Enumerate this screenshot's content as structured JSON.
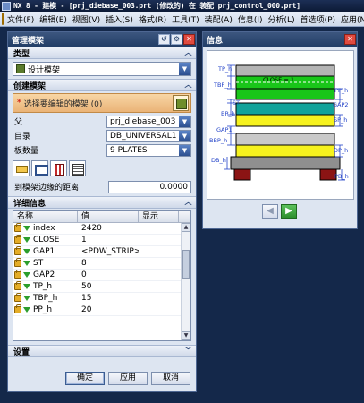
{
  "titlebar": {
    "text": "NX 8 - 建模 - [prj_diebase_003.prt (修改的)  在 装配 prj_control_000.prt]"
  },
  "menu": [
    "文件(F)",
    "编辑(E)",
    "视图(V)",
    "插入(S)",
    "格式(R)",
    "工具(T)",
    "装配(A)",
    "信息(I)",
    "分析(L)",
    "首选项(P)",
    "应用(N)"
  ],
  "dialog": {
    "title": "管理模架",
    "type_section": "类型",
    "type_value": "设计模架",
    "create_section": "创建模架",
    "select_prompt": "选择要编辑的模架 (0)",
    "parent_label": "父",
    "parent_value": "prj_diebase_003",
    "dir_label": "目录",
    "dir_value": "DB_UNIVERSAL1",
    "plates_label": "板数量",
    "plates_value": "9 PLATES",
    "distance_label": "到模架边缘的距离",
    "distance_value": "0.0000",
    "details_section": "详细信息",
    "columns": [
      "名称",
      "值",
      "显示"
    ],
    "rows": [
      {
        "name": "index",
        "value": "2420"
      },
      {
        "name": "CLOSE",
        "value": "1"
      },
      {
        "name": "GAP1",
        "value": "<PDW_STRIP>:..."
      },
      {
        "name": "ST",
        "value": "8"
      },
      {
        "name": "GAP2",
        "value": "0"
      },
      {
        "name": "TP_h",
        "value": "50"
      },
      {
        "name": "TBP_h",
        "value": "15"
      },
      {
        "name": "PP_h",
        "value": "20"
      }
    ],
    "settings_section": "设置",
    "ok": "确定",
    "apply": "应用",
    "cancel": "取消"
  },
  "info": {
    "title": "信息",
    "labels": {
      "tp": "TP_h",
      "close": "CLOSE = 1",
      "tbp": "TBP_h",
      "pp": "PP_h",
      "st": "ST",
      "gap2": "GAP2",
      "bp": "BP_h",
      "sp": "SP_h",
      "gap1": "GAP1",
      "bbp": "BBP_h",
      "dp": "DP_h",
      "db": "DB_h",
      "pb": "PB_h"
    }
  },
  "colors": {
    "top_plate": "#b4b4b4",
    "green_plate": "#19c619",
    "teal_plate": "#12a39a",
    "yellow_plate": "#f6f21e",
    "lower_plate": "#c9c9c9",
    "die_base": "#8f8f8f",
    "feet": "#8b1414",
    "dim_blue": "#2343c8"
  }
}
